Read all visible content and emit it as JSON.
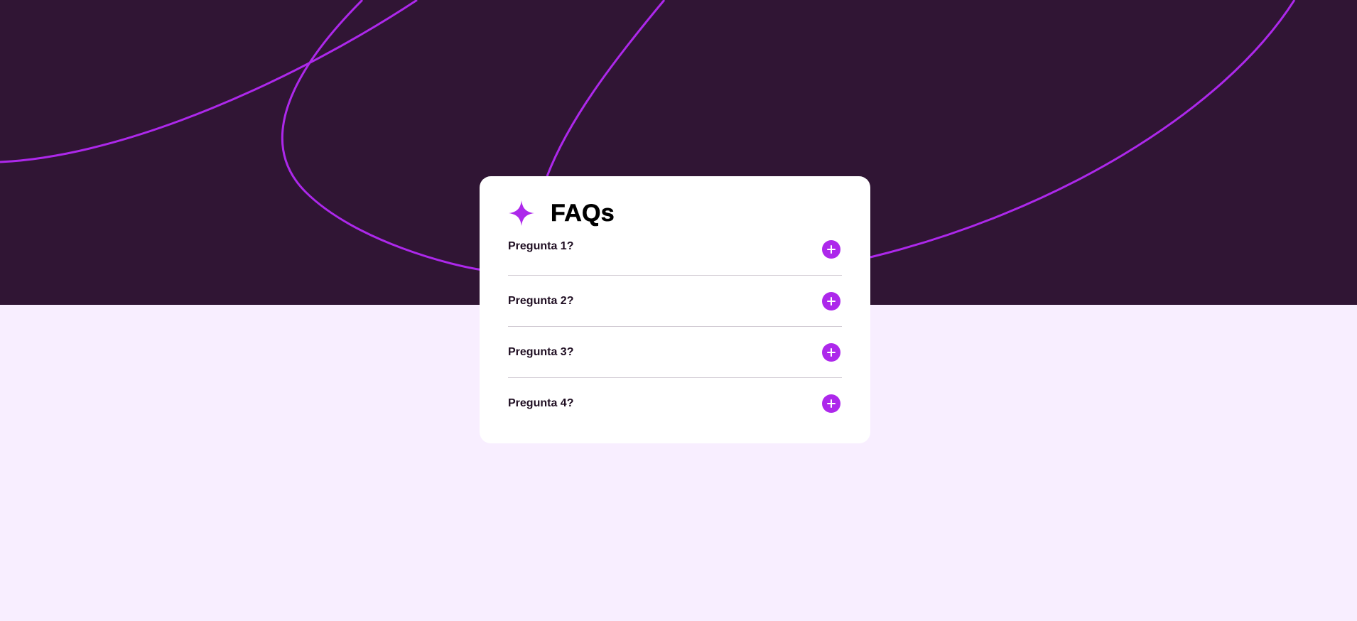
{
  "page": {
    "colors": {
      "hero_background": "#301534",
      "page_background": "#F8EEFF",
      "accent": "#AD28EB",
      "card_background": "#FFFFFF",
      "divider": "#D2CCD4",
      "question_text": "#1F0E22"
    }
  },
  "faq": {
    "title": "FAQs",
    "title_icon": "star-icon",
    "items": [
      {
        "question": "Pregunta 1?",
        "icon": "plus-icon"
      },
      {
        "question": "Pregunta 2?",
        "icon": "plus-icon"
      },
      {
        "question": "Pregunta 3?",
        "icon": "plus-icon"
      },
      {
        "question": "Pregunta 4?",
        "icon": "plus-icon"
      }
    ]
  }
}
